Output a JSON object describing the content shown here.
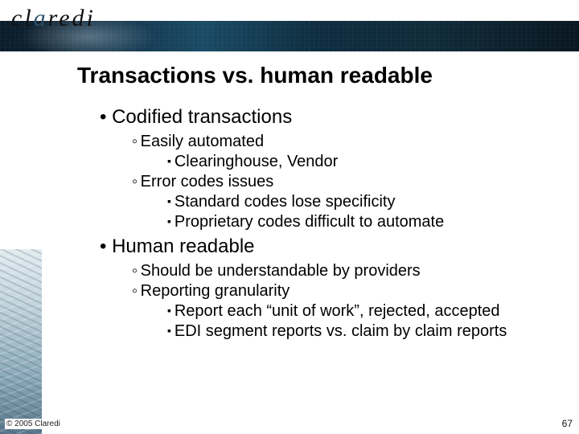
{
  "brand": {
    "name": "claredi"
  },
  "slide": {
    "title": "Transactions vs. human readable",
    "sections": [
      {
        "heading": "Codified transactions",
        "points": [
          {
            "text": "Easily automated",
            "sub": [
              "Clearinghouse, Vendor"
            ]
          },
          {
            "text": "Error codes issues",
            "sub": [
              "Standard codes lose specificity",
              "Proprietary codes difficult to automate"
            ]
          }
        ]
      },
      {
        "heading": "Human readable",
        "points": [
          {
            "text": "Should be understandable by providers",
            "sub": []
          },
          {
            "text": "Reporting granularity",
            "sub": [
              "Report each “unit of work”, rejected, accepted",
              "EDI segment reports vs. claim by claim reports"
            ]
          }
        ]
      }
    ]
  },
  "footer": {
    "copyright": "© 2005 Claredi",
    "page": "67"
  }
}
